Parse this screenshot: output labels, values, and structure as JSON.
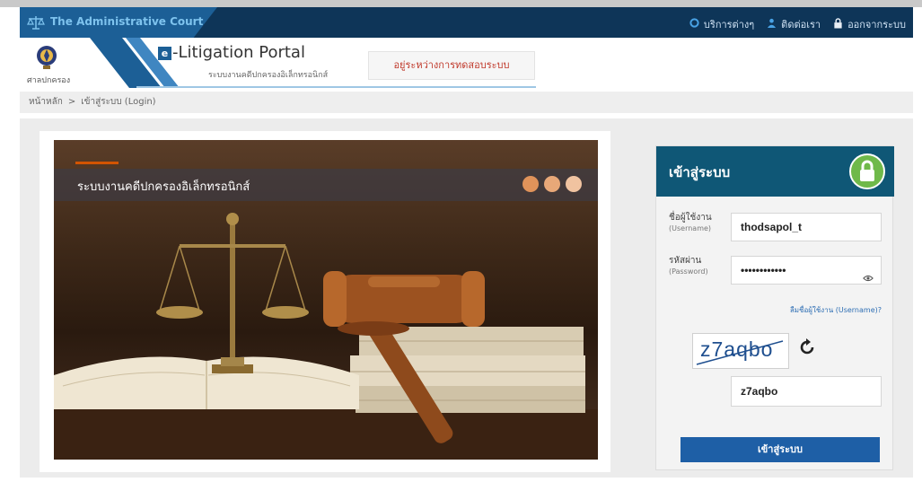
{
  "topbar": {
    "court_name": "The Administrative Court",
    "menu": [
      {
        "icon": "gear-icon",
        "label": "บริการต่างๆ"
      },
      {
        "icon": "user-icon",
        "label": "ติดต่อเรา"
      },
      {
        "icon": "lock-icon",
        "label": "ออกจากระบบ"
      }
    ]
  },
  "header": {
    "logo_label": "ศาลปกครอง",
    "portal_letter": "e",
    "portal_title": "-Litigation Portal",
    "portal_subtitle": "ระบบงานคดีปกครองอิเล็กทรอนิกส์",
    "test_badge": "อยู่ระหว่างการทดสอบระบบ"
  },
  "breadcrumb": {
    "home": "หน้าหลัก",
    "separator": ">",
    "current": "เข้าสู่ระบบ (Login)"
  },
  "hero": {
    "title": "ระบบงานคดีปกครองอิเล็กทรอนิกส์",
    "dot_colors": [
      "#e0935a",
      "#e8a878",
      "#f0c3a0"
    ]
  },
  "login": {
    "title": "เข้าสู่ระบบ",
    "username_label": "ชื่อผู้ใช้งาน",
    "username_sublabel": "(Username)",
    "username_value": "thodsapol_t",
    "password_label": "รหัสผ่าน",
    "password_sublabel": "(Password)",
    "password_value": "••••••••••••",
    "forgot_username": "ลืมชื่อผู้ใช้งาน (Username)?",
    "captcha_text": "z7aqbo",
    "captcha_value": "z7aqbo",
    "submit_label": "เข้าสู่ระบบ"
  },
  "colors": {
    "topbar": "#0e3558",
    "login_header": "#0f5776",
    "button": "#1e5fa6",
    "lock": "#6fb94a"
  }
}
